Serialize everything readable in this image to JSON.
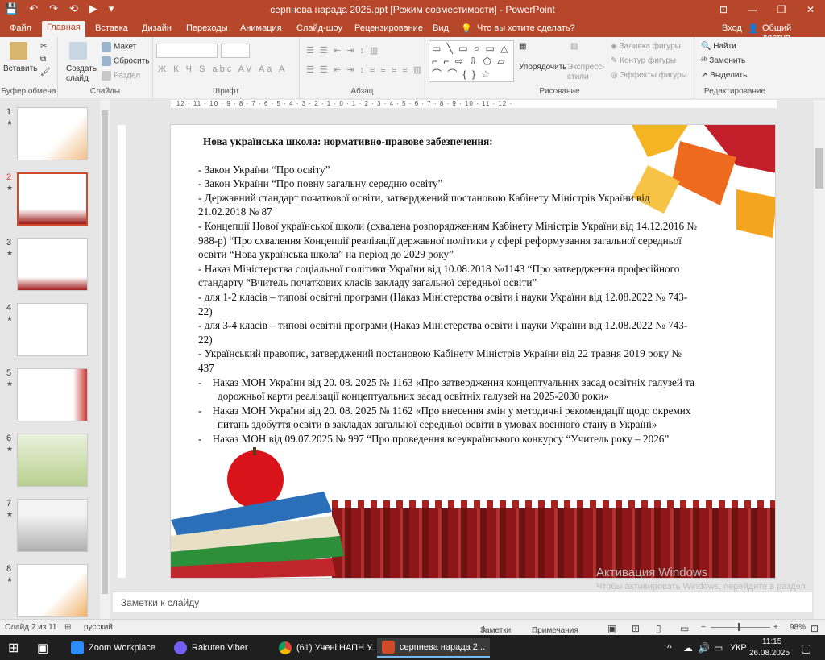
{
  "titlebar": {
    "title": "серпнева нарада 2025.ppt [Режим совместимости] - PowerPoint",
    "qat": [
      "💾",
      "↶",
      "↷",
      "⟲",
      "▶",
      "▾"
    ],
    "controls": [
      "⊡",
      "—",
      "❐",
      "✕"
    ]
  },
  "tabs": [
    "Файл",
    "Главная",
    "Вставка",
    "Дизайн",
    "Переходы",
    "Анимация",
    "Слайд-шоу",
    "Рецензирование",
    "Вид"
  ],
  "tellme": "Что вы хотите сделать?",
  "signin": "Вход",
  "share": "Общий доступ",
  "ribbon": {
    "paste": "Вставить",
    "new_slide": "Создать слайд",
    "layout": "Макет",
    "reset": "Сбросить",
    "section": "Раздел",
    "arrange": "Упорядочить",
    "quick_styles": "Экспресс-стили",
    "shape_fill": "Заливка фигуры",
    "shape_outline": "Контур фигуры",
    "shape_effects": "Эффекты фигуры",
    "find": "Найти",
    "replace": "Заменить",
    "select": "Выделить",
    "font_buttons": "Ж К Ч S abc AV Aa A",
    "para_buttons": "☰ ☰ ⇤ ⇥ ↕ ≡ ≡ ≡ ≡ ▥",
    "shapes": "▭ ╲ ▭ ○ ▭ △ ⌐ ⌐ ⇨ ⇩ ⬠ ▱ ⌒ ⌒ { } ☆",
    "groups": [
      "Буфер обмена",
      "Слайды",
      "Шрифт",
      "Абзац",
      "Рисование",
      "Редактирование"
    ]
  },
  "ruler_text": "· 12 · 11 · 10 · 9 · 8 · 7 · 6 · 5 · 4 · 3 · 2 · 1 · 0 · 1 · 2 · 3 · 4 · 5 · 6 · 7 · 8 · 9 · 10 · 11 · 12 ·",
  "thumbnails": [
    {
      "num": "1",
      "star": "★"
    },
    {
      "num": "2",
      "star": "★"
    },
    {
      "num": "3",
      "star": "★"
    },
    {
      "num": "4",
      "star": "★"
    },
    {
      "num": "5",
      "star": "★"
    },
    {
      "num": "6",
      "star": "★"
    },
    {
      "num": "7",
      "star": "★"
    },
    {
      "num": "8",
      "star": "★"
    }
  ],
  "slide": {
    "heading": "Нова українська школа: нормативно-правове забезпечення:",
    "lines": [
      "-  Закон України “Про освіту”",
      "-  Закон України “Про повну загальну середню  освіту”",
      "- Державний стандарт початкової освіти, затверджений постановою Кабінету Міністрів України від 21.02.2018 № 87",
      "-  Концепції  Нової  української школи (схвалена розпорядженням Кабінету Міністрів України від 14.12.2016 № 988-р)  “Про схвалення Концепції реалізації державної політики у сфері реформування загальної середньої освіти “Нова українська школа” на період до 2029 року”",
      "  -   Наказ Міністерства соціальної політики України від 10.08.2018 №1143 “Про затвердження професійного стандарту “Вчитель початкових класів закладу загальної середньої освіти”",
      "-  для 1-2 класів –  типові освітні програми (Наказ Міністерства освіти і науки України від 12.08.2022 № 743-22)",
      "-      для 3-4 класів –  типові освітні програми (Наказ Міністерства освіти і науки України від 12.08.2022 № 743-22)",
      "  -   Український правопис, затверджений постановою Кабінету Міністрів України від 22 травня 2019 року № 437"
    ],
    "indented": [
      "-    Наказ МОН України  від  20. 08. 2025   № 1163   «Про затвердження концептуальних засад освітніх галузей та дорожньої  карти реалізації концептуальних засад освітніх галузей на 2025-2030 роки»",
      "-    Наказ МОН України  від  20. 08. 2025   № 1162 «Про внесення змін у методичні рекомендації щодо окремих питань здобуття освіти в закладах загальної середньої освіти в умовах воєнного стану в Україні»",
      "-    Наказ МОН від 09.07.2025 № 997 “Про проведення всеукраїнського конкурсу “Учитель року – 2026”"
    ]
  },
  "notes_placeholder": "Заметки к слайду",
  "watermark": {
    "title": "Активация Windows",
    "text": "Чтобы активировать Windows, перейдите в раздел \"Параметры\"."
  },
  "status": {
    "slide_info": "Слайд 2 из 11",
    "language": "русский",
    "notes": "Заметки",
    "comments": "Примечания",
    "zoom": "98%"
  },
  "taskbar": {
    "apps": [
      "Zoom Workplace",
      "Rakuten Viber",
      "(61) Учені НАПН У...",
      "серпнева нарада 2..."
    ],
    "lang": "УКР",
    "time": "11:15",
    "date": "26.08.2025"
  },
  "colors": {
    "accent": "#b7472a",
    "thumb_selected": "#d04a2a"
  }
}
